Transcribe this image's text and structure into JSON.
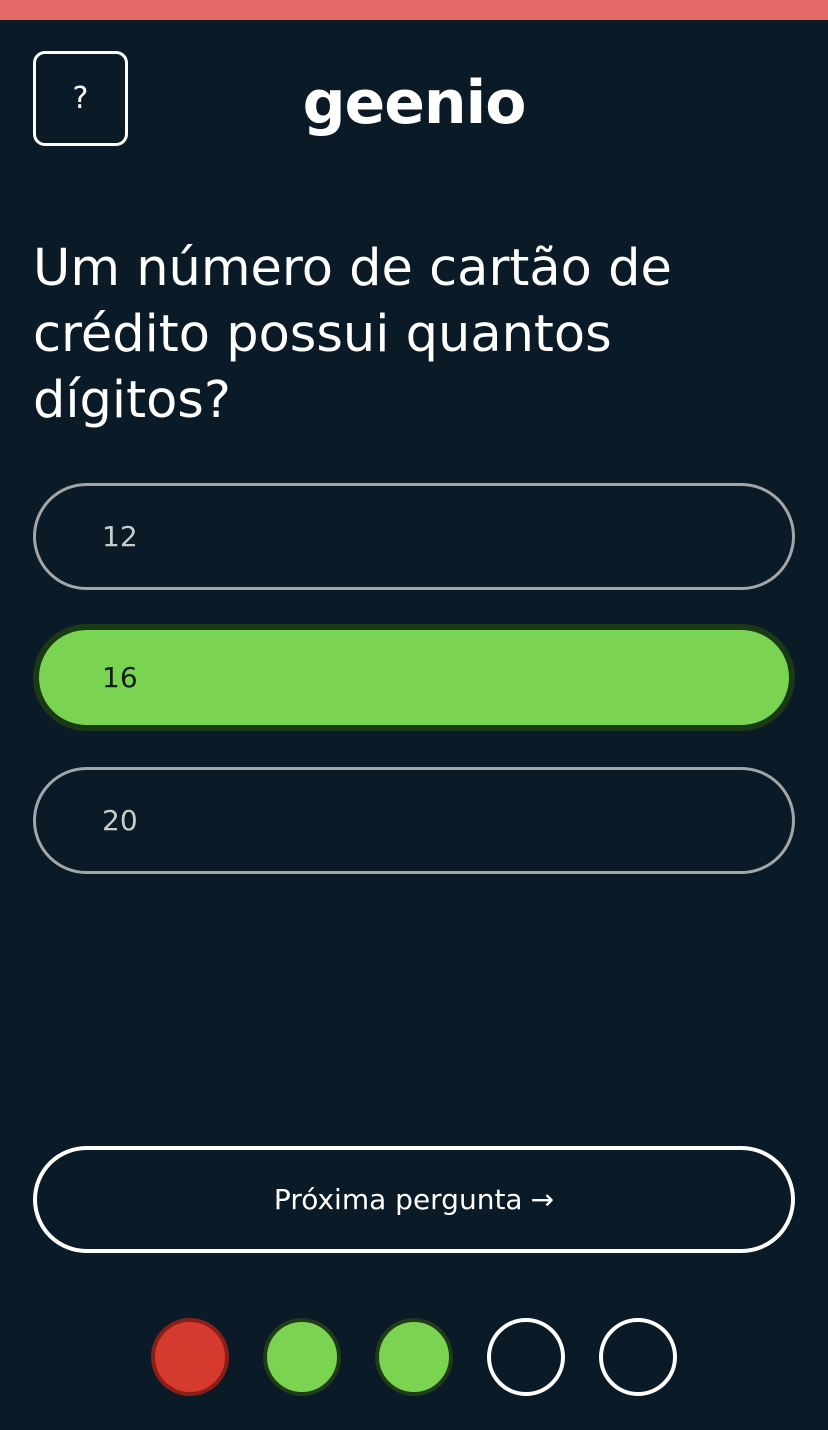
{
  "header": {
    "help_label": "?",
    "logo_text": "geenio"
  },
  "colors": {
    "background": "#0a1a26",
    "top_bar": "#e46a68",
    "correct": "#7ad452",
    "wrong": "#d63a2f"
  },
  "question": {
    "text": "Um número de cartão de crédito possui quantos dígitos?"
  },
  "options": [
    {
      "label": "12",
      "selected": false
    },
    {
      "label": "16",
      "selected": true
    },
    {
      "label": "20",
      "selected": false
    }
  ],
  "next_button": {
    "label": "Próxima pergunta",
    "arrow": "→"
  },
  "progress": {
    "results": [
      "wrong",
      "correct",
      "correct",
      "pending",
      "pending"
    ]
  }
}
